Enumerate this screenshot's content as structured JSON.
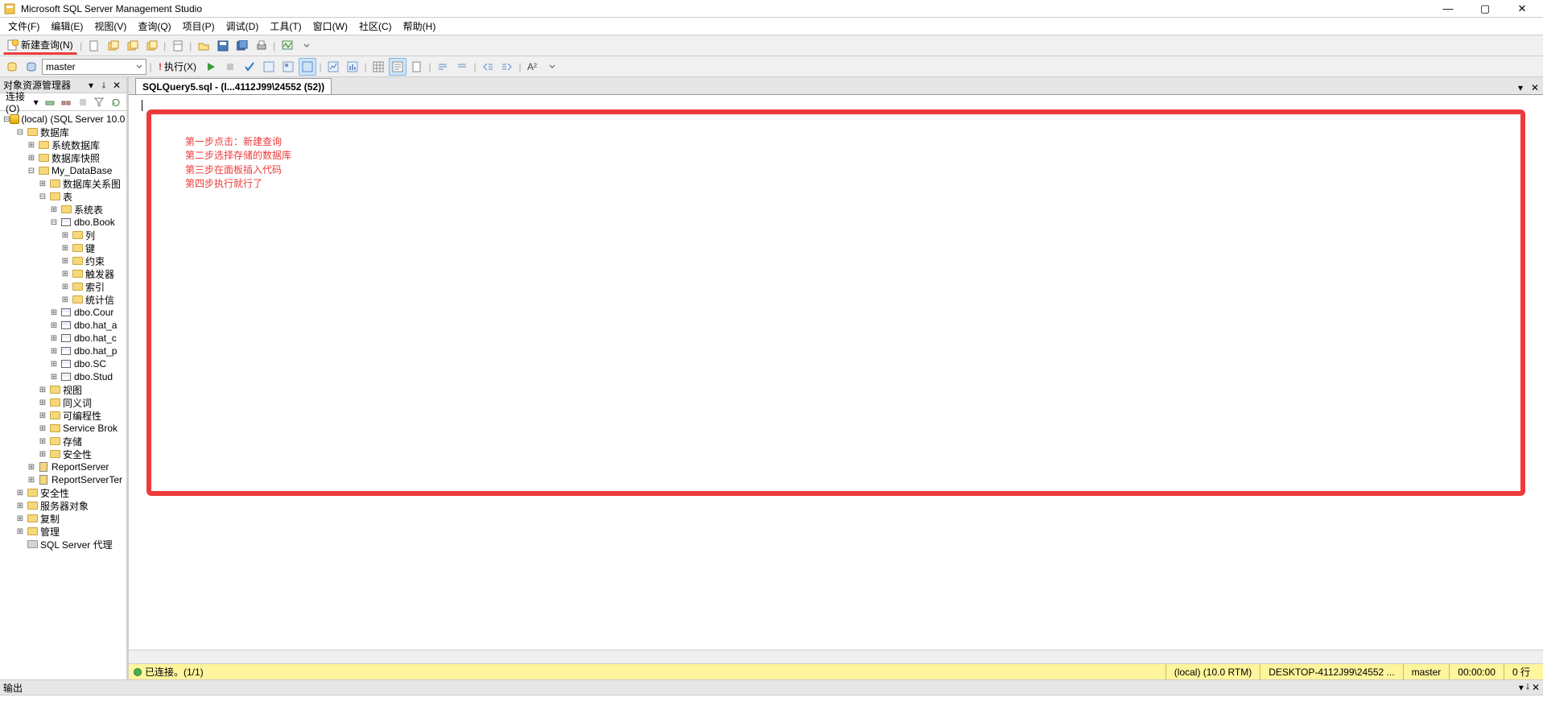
{
  "title": "Microsoft SQL Server Management Studio",
  "menu": [
    "文件(F)",
    "编辑(E)",
    "视图(V)",
    "查询(Q)",
    "项目(P)",
    "调试(D)",
    "工具(T)",
    "窗口(W)",
    "社区(C)",
    "帮助(H)"
  ],
  "toolbar1": {
    "newquery_label": "新建查询(N)"
  },
  "toolbar2": {
    "db_selected": "master",
    "execute_label": "执行(X)"
  },
  "sidebar": {
    "title": "对象资源管理器",
    "connect_label": "连接(O)",
    "tree": [
      {
        "d": 0,
        "e": "-",
        "i": "srv",
        "t": "(local) (SQL Server 10.0"
      },
      {
        "d": 1,
        "e": "-",
        "i": "fold",
        "t": "数据库"
      },
      {
        "d": 2,
        "e": "+",
        "i": "fold",
        "t": "系统数据库"
      },
      {
        "d": 2,
        "e": "+",
        "i": "fold",
        "t": "数据库快照"
      },
      {
        "d": 2,
        "e": "-",
        "i": "fold",
        "t": "My_DataBase",
        "gold": true
      },
      {
        "d": 3,
        "e": "+",
        "i": "fold",
        "t": "数据库关系图"
      },
      {
        "d": 3,
        "e": "-",
        "i": "fold",
        "t": "表"
      },
      {
        "d": 4,
        "e": "+",
        "i": "fold",
        "t": "系统表"
      },
      {
        "d": 4,
        "e": "-",
        "i": "tbl",
        "t": "dbo.Book"
      },
      {
        "d": 5,
        "e": "+",
        "i": "fold",
        "t": "列"
      },
      {
        "d": 5,
        "e": "+",
        "i": "fold",
        "t": "键"
      },
      {
        "d": 5,
        "e": "+",
        "i": "fold",
        "t": "约束"
      },
      {
        "d": 5,
        "e": "+",
        "i": "fold",
        "t": "触发器"
      },
      {
        "d": 5,
        "e": "+",
        "i": "fold",
        "t": "索引"
      },
      {
        "d": 5,
        "e": "+",
        "i": "fold",
        "t": "统计信"
      },
      {
        "d": 4,
        "e": "+",
        "i": "tbl",
        "t": "dbo.Cour"
      },
      {
        "d": 4,
        "e": "+",
        "i": "tbl",
        "t": "dbo.hat_a"
      },
      {
        "d": 4,
        "e": "+",
        "i": "tbl",
        "t": "dbo.hat_c"
      },
      {
        "d": 4,
        "e": "+",
        "i": "tbl",
        "t": "dbo.hat_p"
      },
      {
        "d": 4,
        "e": "+",
        "i": "tbl",
        "t": "dbo.SC"
      },
      {
        "d": 4,
        "e": "+",
        "i": "tbl",
        "t": "dbo.Stud"
      },
      {
        "d": 3,
        "e": "+",
        "i": "fold",
        "t": "视图"
      },
      {
        "d": 3,
        "e": "+",
        "i": "fold",
        "t": "同义词"
      },
      {
        "d": 3,
        "e": "+",
        "i": "fold",
        "t": "可编程性"
      },
      {
        "d": 3,
        "e": "+",
        "i": "fold",
        "t": "Service Brok"
      },
      {
        "d": 3,
        "e": "+",
        "i": "fold",
        "t": "存储"
      },
      {
        "d": 3,
        "e": "+",
        "i": "fold",
        "t": "安全性"
      },
      {
        "d": 2,
        "e": "+",
        "i": "doc",
        "t": "ReportServer",
        "gold": true
      },
      {
        "d": 2,
        "e": "+",
        "i": "doc",
        "t": "ReportServerTer",
        "gold": true
      },
      {
        "d": 1,
        "e": "+",
        "i": "fold",
        "t": "安全性"
      },
      {
        "d": 1,
        "e": "+",
        "i": "fold",
        "t": "服务器对象"
      },
      {
        "d": 1,
        "e": "+",
        "i": "fold",
        "t": "复制"
      },
      {
        "d": 1,
        "e": "+",
        "i": "fold",
        "t": "管理"
      },
      {
        "d": 1,
        "e": " ",
        "i": "foldg",
        "t": "SQL Server 代理"
      }
    ]
  },
  "tab": {
    "label": "SQLQuery5.sql - (l...4112J99\\24552 (52))"
  },
  "annotations": {
    "lines": [
      "第一步点击：新建查询",
      "第二步选择存储的数据库",
      "第三步在面板插入代码",
      "第四步执行就行了"
    ]
  },
  "status": {
    "connected": "已连接。(1/1)",
    "server": "(local) (10.0 RTM)",
    "user": "DESKTOP-4112J99\\24552 ...",
    "db": "master",
    "time": "00:00:00",
    "rows": "0 行"
  },
  "output": {
    "title": "输出"
  }
}
